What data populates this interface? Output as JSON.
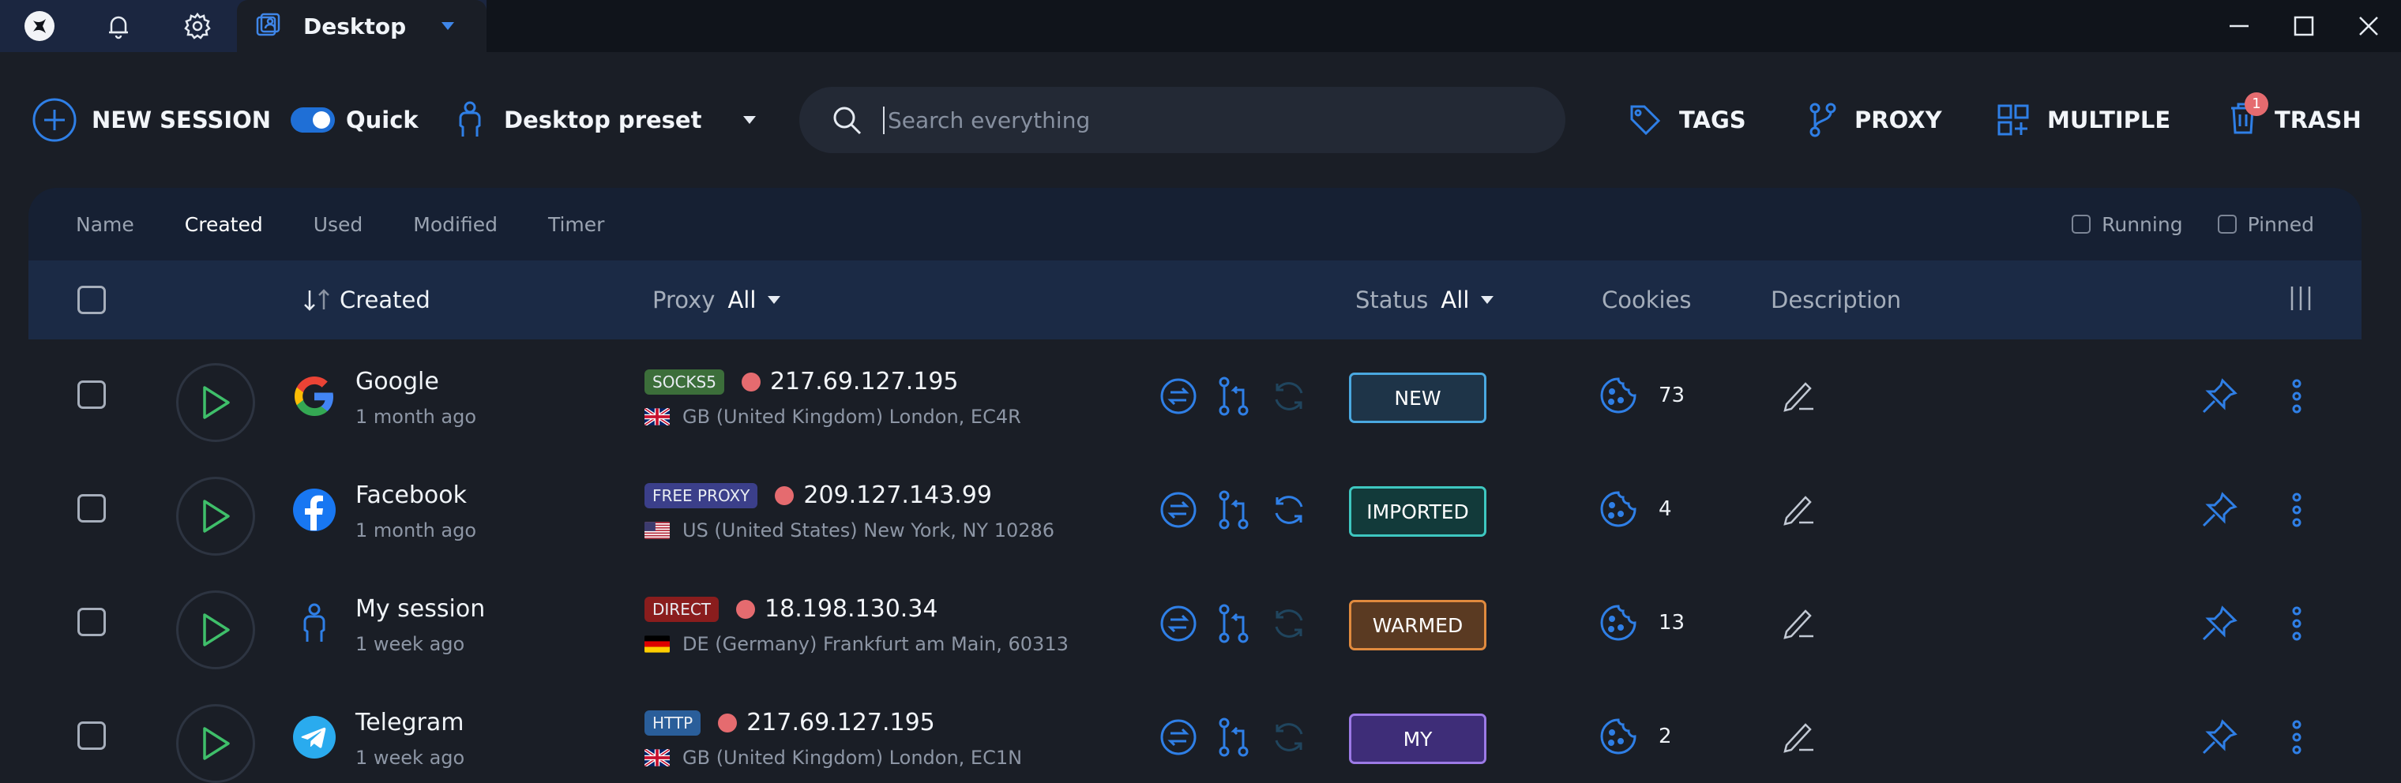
{
  "titlebar": {
    "tab_title": "Desktop",
    "icons": [
      "app-logo-icon",
      "bell-icon",
      "gear-icon",
      "desktop-profile-icon",
      "dropdown-caret-icon"
    ],
    "window_controls": [
      "minimize-icon",
      "maximize-icon",
      "close-icon"
    ]
  },
  "toolbar": {
    "new_session_label": "NEW SESSION",
    "quick_label": "Quick",
    "quick_enabled": true,
    "preset_label": "Desktop preset",
    "search_placeholder": "Search everything",
    "tags_label": "TAGS",
    "proxy_label": "PROXY",
    "multiple_label": "MULTIPLE",
    "trash_label": "TRASH",
    "trash_badge": "1"
  },
  "sort_tabs": [
    {
      "label": "Name",
      "active": false
    },
    {
      "label": "Created",
      "active": true
    },
    {
      "label": "Used",
      "active": false
    },
    {
      "label": "Modified",
      "active": false
    },
    {
      "label": "Timer",
      "active": false
    }
  ],
  "filters": {
    "running_label": "Running",
    "pinned_label": "Pinned"
  },
  "table_header": {
    "created": "Created",
    "proxy": "Proxy",
    "proxy_filter": "All",
    "status": "Status",
    "status_filter": "All",
    "cookies": "Cookies",
    "description": "Description"
  },
  "sessions": [
    {
      "name": "Google",
      "time": "1 month ago",
      "icon": "google-icon",
      "proxy_type": "SOCKS5",
      "proxy_type_color": "#3c6e3a",
      "ip": "217.69.127.195",
      "location": "GB (United Kingdom) London, EC4R",
      "flag": "uk-flag-icon",
      "status": "NEW",
      "status_bg": "#1e3448",
      "status_border": "#4aa8e0",
      "cookies": "73",
      "sync_active": false
    },
    {
      "name": "Facebook",
      "time": "1 month ago",
      "icon": "facebook-icon",
      "proxy_type": "FREE PROXY",
      "proxy_type_color": "#3b3f8a",
      "ip": "209.127.143.99",
      "location": "US (United States) New York, NY 10286",
      "flag": "us-flag-icon",
      "status": "IMPORTED",
      "status_bg": "#123a3a",
      "status_border": "#3ec7c0",
      "cookies": "4",
      "sync_active": true
    },
    {
      "name": "My session",
      "time": "1 week ago",
      "icon": "person-icon",
      "proxy_type": "DIRECT",
      "proxy_type_color": "#8a1d1d",
      "ip": "18.198.130.34",
      "location": "DE (Germany) Frankfurt am Main, 60313",
      "flag": "de-flag-icon",
      "status": "WARMED",
      "status_bg": "#5a3a22",
      "status_border": "#e08a3e",
      "cookies": "13",
      "sync_active": false
    },
    {
      "name": "Telegram",
      "time": "1 week ago",
      "icon": "telegram-icon",
      "proxy_type": "HTTP",
      "proxy_type_color": "#2a5e9a",
      "ip": "217.69.127.195",
      "location": "GB (United Kingdom) London, EC1N",
      "flag": "uk-flag-icon",
      "status": "MY",
      "status_bg": "#3e2d78",
      "status_border": "#9c7ae6",
      "cookies": "2",
      "sync_active": false
    }
  ],
  "colors": {
    "accent": "#2f7fe6",
    "play_green": "#3fbf6a",
    "proxy_dot": "#e56b6f"
  }
}
